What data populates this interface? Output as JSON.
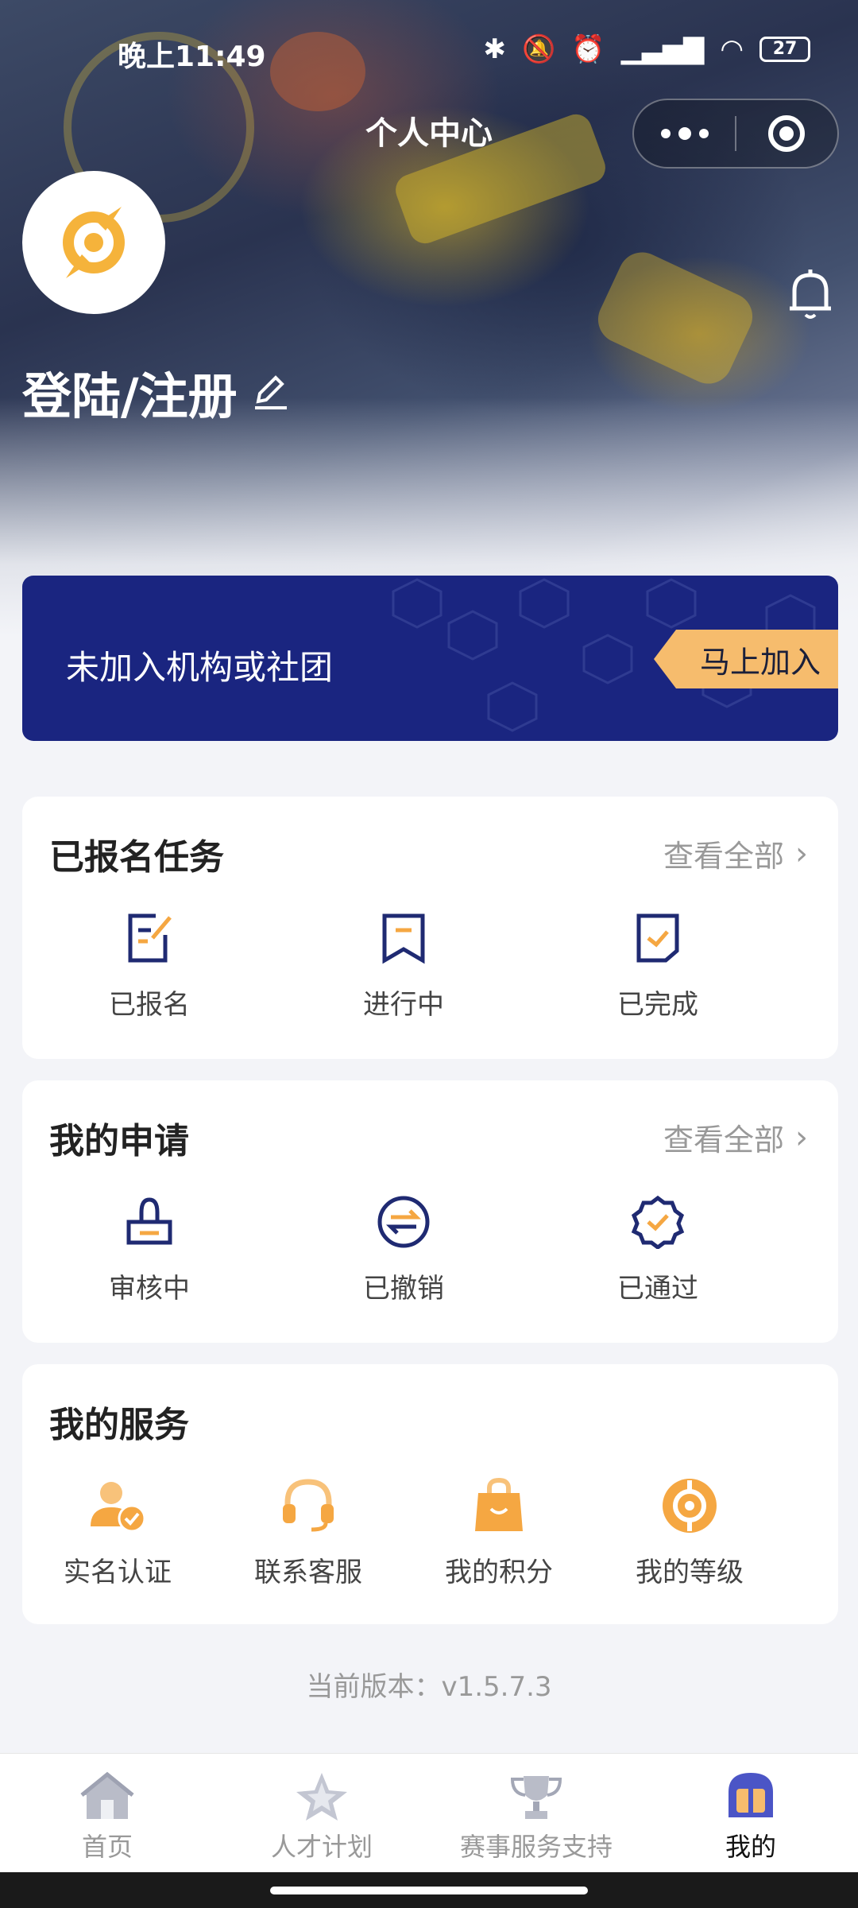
{
  "status_bar": {
    "time": "晚上11:49",
    "battery": "27"
  },
  "nav": {
    "title": "个人中心"
  },
  "profile": {
    "login_label": "登陆/注册"
  },
  "org_banner": {
    "text": "未加入机构或社团",
    "join_label": "马上加入"
  },
  "tasks": {
    "title": "已报名任务",
    "view_all": "查看全部",
    "items": [
      {
        "label": "已报名",
        "icon": "signup-doc-icon"
      },
      {
        "label": "进行中",
        "icon": "bookmark-icon"
      },
      {
        "label": "已完成",
        "icon": "check-box-icon"
      }
    ]
  },
  "applications": {
    "title": "我的申请",
    "view_all": "查看全部",
    "items": [
      {
        "label": "审核中",
        "icon": "stamp-icon"
      },
      {
        "label": "已撤销",
        "icon": "exchange-icon"
      },
      {
        "label": "已通过",
        "icon": "badge-check-icon"
      }
    ]
  },
  "services": {
    "title": "我的服务",
    "items": [
      {
        "label": "实名认证",
        "icon": "user-verified-icon"
      },
      {
        "label": "联系客服",
        "icon": "headset-icon"
      },
      {
        "label": "我的积分",
        "icon": "shopping-bag-icon"
      },
      {
        "label": "我的等级",
        "icon": "level-icon"
      }
    ]
  },
  "version": "当前版本：v1.5.7.3",
  "tabbar": {
    "items": [
      {
        "label": "首页",
        "icon": "home-icon"
      },
      {
        "label": "人才计划",
        "icon": "star-icon"
      },
      {
        "label": "赛事服务支持",
        "icon": "trophy-icon"
      },
      {
        "label": "我的",
        "icon": "helmet-icon"
      }
    ],
    "active": "我的"
  },
  "colors": {
    "navy": "#1a2580",
    "accent": "#f6bc6d",
    "orange_icon": "#f5a742",
    "bg": "#f3f4f8"
  }
}
